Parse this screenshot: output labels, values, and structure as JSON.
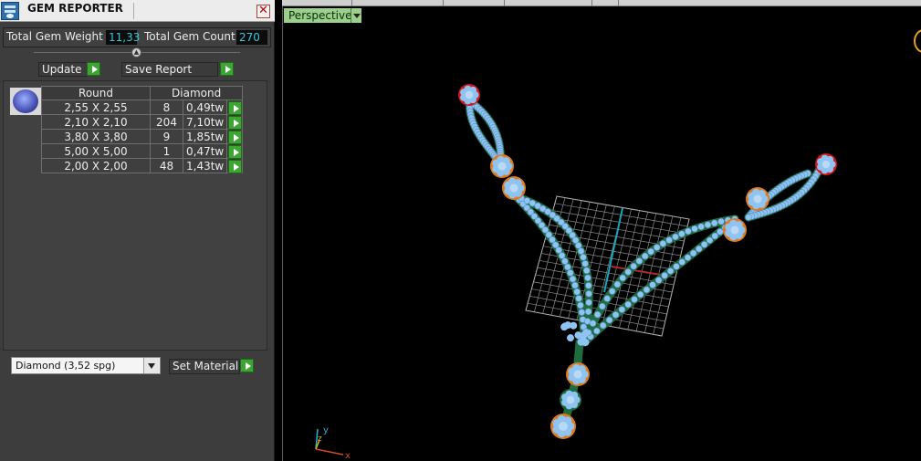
{
  "panel": {
    "title": "GEM REPORTER",
    "close_label": "✕",
    "total_weight_label": "Total Gem Weight",
    "total_weight_value": "11,33",
    "total_count_label": "Total Gem Count",
    "total_count_value": "270",
    "update_label": "Update",
    "save_report_label": "Save Report",
    "table": {
      "col_shape": "Round",
      "col_material": "Diamond",
      "rows": [
        {
          "size": "2,55 X 2,55",
          "count": "8",
          "weight": "0,49tw"
        },
        {
          "size": "2,10 X 2,10",
          "count": "204",
          "weight": "7,10tw"
        },
        {
          "size": "3,80 X 3,80",
          "count": "9",
          "weight": "1,85tw"
        },
        {
          "size": "5,00 X 5,00",
          "count": "1",
          "weight": "0,47tw"
        },
        {
          "size": "2,00 X 2,00",
          "count": "48",
          "weight": "1,43tw"
        }
      ]
    },
    "material_select": "Diamond     (3,52 spg)",
    "set_material_label": "Set Material"
  },
  "viewport": {
    "view_name": "Perspective",
    "axis_y": "y",
    "axis_z": "z",
    "axis_x": "x"
  },
  "colors": {
    "accent_green": "#3ea434",
    "value_cyan": "#38c7d8",
    "panel_bg": "#3d3d3d",
    "gem_blue": "#8ec3f2",
    "prong_red": "#d11a1a",
    "prong_orange": "#e07a1e",
    "metal_green": "#1c6b3c"
  }
}
